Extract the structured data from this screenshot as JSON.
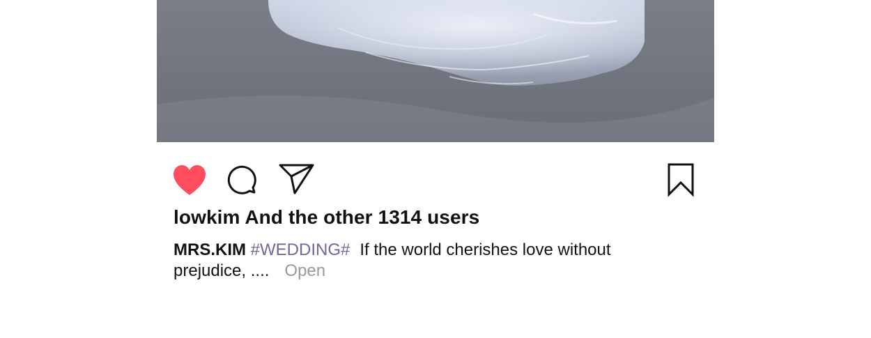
{
  "post": {
    "likes_text": "lowkim And the other 1314 users",
    "caption": {
      "author": "MRS.KIM",
      "hashtag": "#WEDDING#",
      "text_line1": "If the world cherishes love without",
      "text_line2": "prejudice, ....",
      "more_label": "Open"
    },
    "liked": true
  },
  "icons": {
    "like": "heart-icon",
    "comment": "speech-bubble-icon",
    "share": "paper-plane-icon",
    "save": "bookmark-icon"
  },
  "colors": {
    "heart": "#ff4d5e",
    "hashtag": "#6b6a9b",
    "more_link": "#9a9a9a",
    "text": "#111111"
  }
}
